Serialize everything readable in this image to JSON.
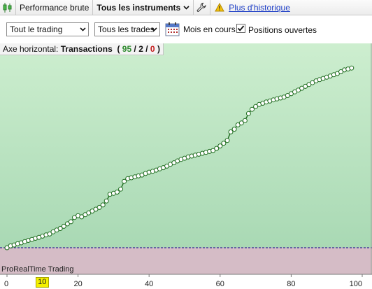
{
  "toolbar": {
    "performance_label": "Performance brute",
    "instruments_label": "Tous les instruments",
    "history_link": "Plus d'historique"
  },
  "filters": {
    "trading_select": "Tout le trading",
    "trades_select": "Tous les trades",
    "month_label": "Mois en cours",
    "open_positions_label": "Positions ouvertes",
    "open_positions_checked": true
  },
  "chart_header": {
    "axis_prefix": "Axe horizontal:",
    "axis_name": "Transactions",
    "open_paren": "(",
    "count_green": "95",
    "sep1": "/",
    "count_black": "2",
    "sep2": "/",
    "count_red": "0",
    "close_paren": ")"
  },
  "brand": "ProRealTime Trading",
  "colors": {
    "profit_area": "#bfe6c3",
    "loss_area": "#d7bcc7",
    "line": "#1e6b1e",
    "marker_fill": "#ffffff",
    "baseline": "#4b3f9a"
  },
  "chart_data": {
    "type": "line",
    "x_axis": {
      "range": [
        0,
        100
      ],
      "ticks": [
        0,
        20,
        40,
        60,
        80,
        100
      ],
      "highlighted_tick": 10
    },
    "series": [
      {
        "points": [
          [
            0,
            0.0
          ],
          [
            1,
            0.6
          ],
          [
            2,
            0.9
          ],
          [
            3,
            1.3
          ],
          [
            4,
            1.6
          ],
          [
            5,
            2.0
          ],
          [
            6,
            2.4
          ],
          [
            7,
            2.7
          ],
          [
            8,
            3.1
          ],
          [
            9,
            3.4
          ],
          [
            10,
            3.8
          ],
          [
            11,
            4.2
          ],
          [
            12,
            4.5
          ],
          [
            13,
            5.2
          ],
          [
            14,
            5.8
          ],
          [
            15,
            6.3
          ],
          [
            16,
            7.0
          ],
          [
            17,
            7.8
          ],
          [
            18,
            8.5
          ],
          [
            19,
            9.9
          ],
          [
            20,
            10.5
          ],
          [
            21,
            10.1
          ],
          [
            22,
            10.8
          ],
          [
            23,
            11.4
          ],
          [
            24,
            12.0
          ],
          [
            25,
            12.6
          ],
          [
            26,
            13.2
          ],
          [
            27,
            14.0
          ],
          [
            28,
            15.3
          ],
          [
            29,
            17.5
          ],
          [
            30,
            17.8
          ],
          [
            31,
            18.2
          ],
          [
            32,
            19.2
          ],
          [
            33,
            21.7
          ],
          [
            34,
            22.6
          ],
          [
            35,
            22.9
          ],
          [
            36,
            23.2
          ],
          [
            37,
            23.5
          ],
          [
            38,
            23.8
          ],
          [
            39,
            24.3
          ],
          [
            40,
            24.7
          ],
          [
            41,
            25.0
          ],
          [
            42,
            25.4
          ],
          [
            43,
            25.8
          ],
          [
            44,
            26.2
          ],
          [
            45,
            26.7
          ],
          [
            46,
            27.3
          ],
          [
            47,
            27.8
          ],
          [
            48,
            28.4
          ],
          [
            49,
            28.9
          ],
          [
            50,
            29.3
          ],
          [
            51,
            29.7
          ],
          [
            52,
            30.0
          ],
          [
            53,
            30.3
          ],
          [
            54,
            30.6
          ],
          [
            55,
            30.9
          ],
          [
            56,
            31.2
          ],
          [
            57,
            31.5
          ],
          [
            58,
            31.8
          ],
          [
            59,
            32.5
          ],
          [
            60,
            33.3
          ],
          [
            61,
            34.2
          ],
          [
            62,
            35.1
          ],
          [
            63,
            37.9
          ],
          [
            64,
            38.8
          ],
          [
            65,
            40.2
          ],
          [
            66,
            40.8
          ],
          [
            67,
            41.6
          ],
          [
            68,
            43.9
          ],
          [
            69,
            45.3
          ],
          [
            70,
            46.2
          ],
          [
            71,
            46.9
          ],
          [
            72,
            47.3
          ],
          [
            73,
            47.7
          ],
          [
            74,
            48.0
          ],
          [
            75,
            48.4
          ],
          [
            76,
            48.7
          ],
          [
            77,
            49.0
          ],
          [
            78,
            49.3
          ],
          [
            79,
            49.8
          ],
          [
            80,
            50.4
          ],
          [
            81,
            51.0
          ],
          [
            82,
            51.6
          ],
          [
            83,
            52.2
          ],
          [
            84,
            52.8
          ],
          [
            85,
            53.4
          ],
          [
            86,
            54.0
          ],
          [
            87,
            54.6
          ],
          [
            88,
            55.0
          ],
          [
            89,
            55.4
          ],
          [
            90,
            55.8
          ],
          [
            91,
            56.2
          ],
          [
            92,
            56.6
          ],
          [
            93,
            57.0
          ],
          [
            94,
            57.6
          ],
          [
            95,
            58.2
          ],
          [
            96,
            58.5
          ],
          [
            97,
            58.8
          ]
        ]
      }
    ],
    "y_axis": {
      "range": [
        -12,
        65
      ],
      "baseline": 0,
      "tick_labels_shown": false
    }
  }
}
